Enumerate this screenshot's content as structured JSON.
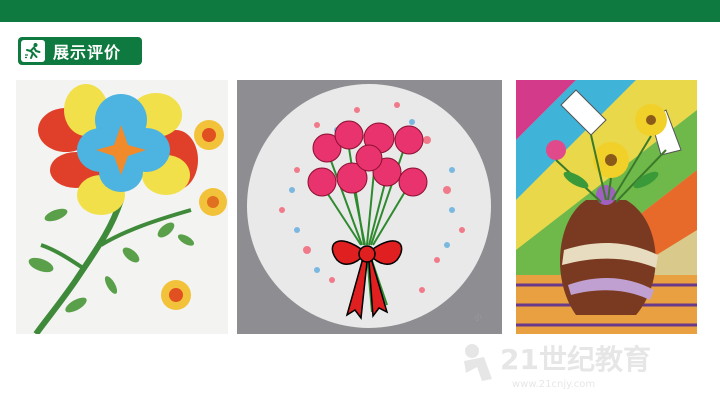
{
  "header": {
    "section_title": "展示评价",
    "icon": "running-person-icon",
    "bar_color": "#0f7a3f"
  },
  "artworks": [
    {
      "name": "flower-drawing-1"
    },
    {
      "name": "carnation-bouquet-drawing"
    },
    {
      "name": "flower-vase-drawing"
    }
  ],
  "watermark": {
    "caption": "小",
    "brand_text": "21世纪教育",
    "brand_subtext": "www.21cnjy.com"
  }
}
